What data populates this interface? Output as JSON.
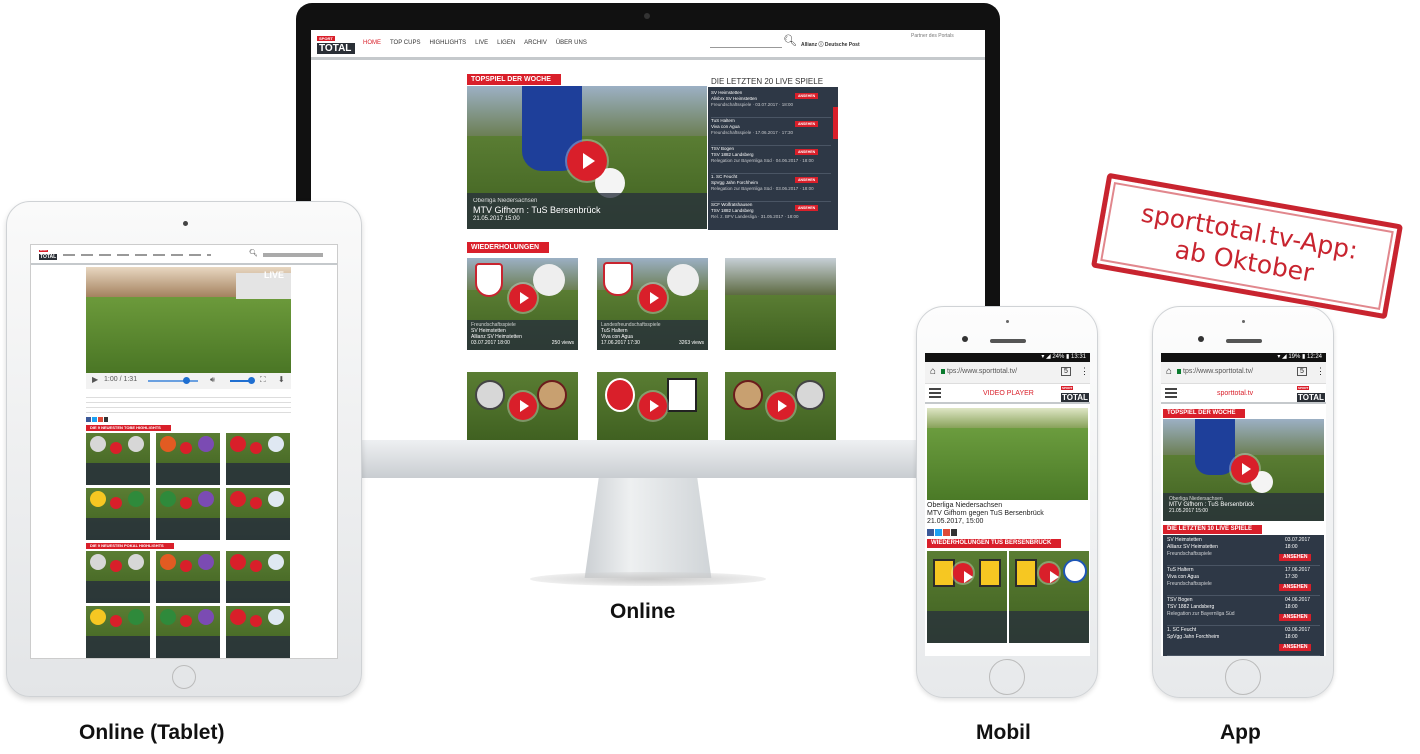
{
  "labels": {
    "online": "Online",
    "tablet": "Online (Tablet)",
    "mobil": "Mobil",
    "app": "App"
  },
  "stamp": {
    "line1": "sporttotal.tv-App:",
    "line2": "ab Oktober"
  },
  "brand": {
    "sport": "SPORT",
    "total": "TOTAL",
    "accent": "#d91f2a",
    "dark": "#2a2f36"
  },
  "desktop": {
    "nav": [
      "HOME",
      "TOP CUPS",
      "HIGHLIGHTS",
      "LIVE",
      "LIGEN",
      "ARCHIV",
      "ÜBER UNS"
    ],
    "partner_label": "Partner des Portals",
    "partners": "Allianz ⓘ  Deutsche Post",
    "top_game": {
      "ribbon": "TOPSPIEL DER WOCHE",
      "league": "Oberliga Niedersachsen",
      "match": "MTV Gifhorn : TuS Bersenbrück",
      "date": "21.05.2017 15:00"
    },
    "live_list": {
      "heading": "DIE LETZTEN 20 LIVE SPIELE",
      "button": "ANSEHEN",
      "items": [
        {
          "home": "SV Heimstetten",
          "away": "Alisbrx SV Heimstetten",
          "meta": "Freundschaftsspiele · 03.07.2017 · 18:00"
        },
        {
          "home": "TuS Haltern",
          "away": "Viva con Agua",
          "meta": "Freundschaftsspiele · 17.06.2017 · 17:30"
        },
        {
          "home": "TSV Bogen",
          "away": "TSV 1882 Landsberg",
          "meta": "Relegation zur Bayernliga Süd · 04.06.2017 · 18:00"
        },
        {
          "home": "1. SC Feucht",
          "away": "SpVgg Jahn Forchheim",
          "meta": "Relegation zur Bayernliga Süd · 03.06.2017 · 18:00"
        },
        {
          "home": "SCF Wolfratshausen",
          "away": "TSV 1882 Landsberg",
          "meta": "Rel. z. BFV Landesliga · 31.05.2017 · 18:00"
        }
      ]
    },
    "replays": {
      "ribbon": "WIEDERHOLUNGEN",
      "cards": [
        {
          "league": "Freundschaftsspiele",
          "home": "SV Heimstetten",
          "away": "Allianz SV Heimstetten",
          "date": "03.07.2017 18:00",
          "views": "250 views"
        },
        {
          "league": "Landesfreundschaftsspiele",
          "home": "TuS Haltern",
          "away": "Viva con Agua",
          "date": "17.06.2017 17:30",
          "views": "3263 views"
        },
        {
          "league": "",
          "home": "",
          "away": "",
          "date": "",
          "views": ""
        }
      ]
    }
  },
  "tablet": {
    "time": "1:00 / 1:31",
    "live": "LIVE",
    "section1": "DIE 9 NEUESTEN TOBE HIGHLIGHTS",
    "section2": "DIE 9 NEUESTEN POKAL HIGHLIGHTS"
  },
  "mobile": {
    "url": "tps://www.sporttotal.tv/",
    "tab_count": "5",
    "status": "▾ ◢ 24% ▮ 13:31",
    "title": "VIDEO PLAYER",
    "league": "Oberliga Niedersachsen",
    "match": "MTV Gifhorn gegen TuS Bersenbrück",
    "date": "21.05.2017, 15:00",
    "ribbon": "WIEDERHOLUNGEN TUS BERSENBRÜCK"
  },
  "app": {
    "url": "tps://www.sporttotal.tv/",
    "tab_count": "5",
    "status": "▾ ◢ 19% ▮ 12:24",
    "title": "sporttotal.tv",
    "ribbon1": "TOPSPIEL DER WOCHE",
    "league": "Oberliga Niedersachsen",
    "match": "MTV Gifhorn : TuS Bersenbrück",
    "date": "21.05.2017 15:00",
    "ribbon2": "DIE LETZTEN 10 LIVE SPIELE",
    "button": "ANSEHEN",
    "items": [
      {
        "home": "SV Heimstetten",
        "away": "Allianz SV Heimstetten",
        "meta": "Freundschaftsspiele",
        "date": "03.07.2017",
        "time": "18:00"
      },
      {
        "home": "TuS Haltern",
        "away": "Viva con Agua",
        "meta": "Freundschaftsspiele",
        "date": "17.06.2017",
        "time": "17:30"
      },
      {
        "home": "TSV Bogen",
        "away": "TSV 1882 Landsberg",
        "meta": "Relegation zur Bayernliga Süd",
        "date": "04.06.2017",
        "time": "18:00"
      },
      {
        "home": "1. SC Feucht",
        "away": "SpVgg Jahn Forchheim",
        "meta": "",
        "date": "03.06.2017",
        "time": "18:00"
      }
    ]
  }
}
